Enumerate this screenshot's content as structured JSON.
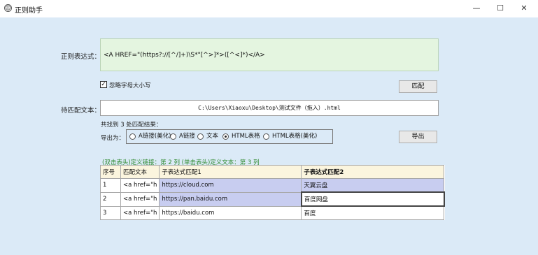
{
  "window": {
    "title": "正则助手",
    "minimize": "—",
    "maximize": "☐",
    "close": "✕"
  },
  "regex": {
    "label": "正则表达式：",
    "value": "<A HREF=\"(https?://[^/]+)\\S*\"[^>]*>([^<]*)</A>"
  },
  "ignore_case": {
    "label": "忽略字母大小写",
    "checked": true
  },
  "match_button": "匹配",
  "target": {
    "label": "待匹配文本：",
    "value": "C:\\Users\\Xiaoxu\\Desktop\\测试文件（拖入）.html"
  },
  "result_count": "共找到 3 处匹配结果：",
  "export": {
    "label": "导出为：",
    "options": [
      "A链接(美化)",
      "A链接",
      "文本",
      "HTML表格",
      "HTML表格(美化)"
    ],
    "selected": "HTML表格",
    "button": "导出"
  },
  "hint": "(双击表头)定义链接：第 2 列   (单击表头)定义文本：第 3 列",
  "table": {
    "headers": [
      "序号",
      "匹配文本",
      "子表达式匹配1",
      "子表达式匹配2"
    ],
    "rows": [
      [
        "1",
        "<a href=\"h",
        "https://cloud.com",
        "天翼云盘"
      ],
      [
        "2",
        "<a href=\"h",
        "https://pan.baidu.com",
        "百度网盘"
      ],
      [
        "3",
        "<a href=\"h",
        "https://baidu.com",
        "百度"
      ]
    ]
  }
}
